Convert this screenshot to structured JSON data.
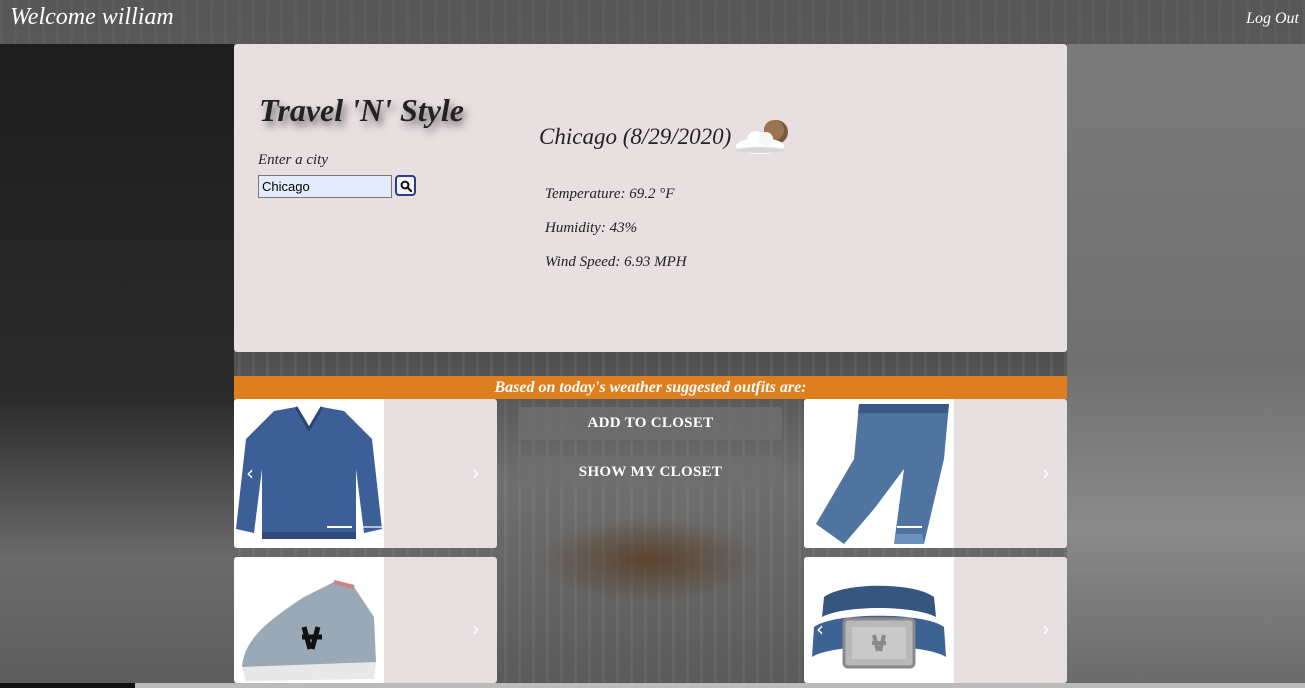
{
  "header": {
    "welcome": "Welcome william",
    "logout": "Log Out"
  },
  "brand": "Travel 'N' Style",
  "search": {
    "label": "Enter a city",
    "value": "Chicago"
  },
  "weather": {
    "heading": "Chicago (8/29/2020)",
    "icon": "partly-cloudy-icon",
    "temperature": "Temperature: 69.2 °F",
    "humidity": "Humidity: 43%",
    "wind": "Wind Speed: 6.93 MPH"
  },
  "suggestions": {
    "banner": "Based on today's weather suggested outfits are:",
    "add_button": "ADD TO CLOSET",
    "show_button": "SHOW MY CLOSET",
    "items": [
      {
        "name": "sweater-image",
        "active_slide": 1
      },
      {
        "name": "jeans-image",
        "active_slide": 1
      },
      {
        "name": "sneaker-image"
      },
      {
        "name": "belt-image"
      }
    ]
  },
  "colors": {
    "accent": "#dd7f1e",
    "panel": "#e8dfe0"
  }
}
